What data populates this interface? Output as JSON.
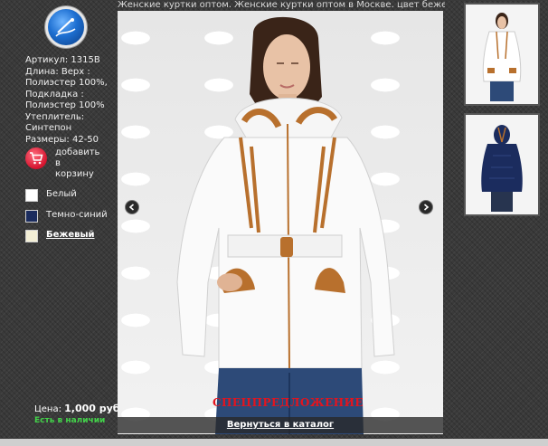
{
  "page": {
    "title": "Женские куртки оптом. Женские куртки оптом в Москве. цвет бежевый"
  },
  "product": {
    "specs": [
      "Артикул: 1315B",
      "Длина: Верх :",
      "Полиэстер 100%,",
      "Подкладка :",
      "Полиэстер 100%",
      "Утеплитель:",
      "Синтепон",
      "Размеры: 42-50"
    ],
    "cart_label_lines": [
      "добавить",
      "в",
      "корзину"
    ],
    "colors": [
      {
        "label": "Белый",
        "swatch": "#ffffff",
        "active": false
      },
      {
        "label": "Темно-синий",
        "swatch": "#1b2c5e",
        "active": false
      },
      {
        "label": "Бежевый",
        "swatch": "#f3efd6",
        "active": true
      }
    ],
    "price_label": "Цена:",
    "price_value": "1,000 руб.",
    "stock": "Есть в наличии"
  },
  "main": {
    "promo": "СПЕЦПРЕДЛОЖЕНИЕ",
    "back_link": "Вернуться в каталог"
  },
  "icons": {
    "logo": "logo-icon",
    "cart": "cart-icon",
    "prev": "chevron-left-icon",
    "next": "chevron-right-icon"
  },
  "colors": {
    "stock_green": "#43d24a",
    "promo_red": "#e4141e",
    "jacket_trim": "#b8702d"
  }
}
